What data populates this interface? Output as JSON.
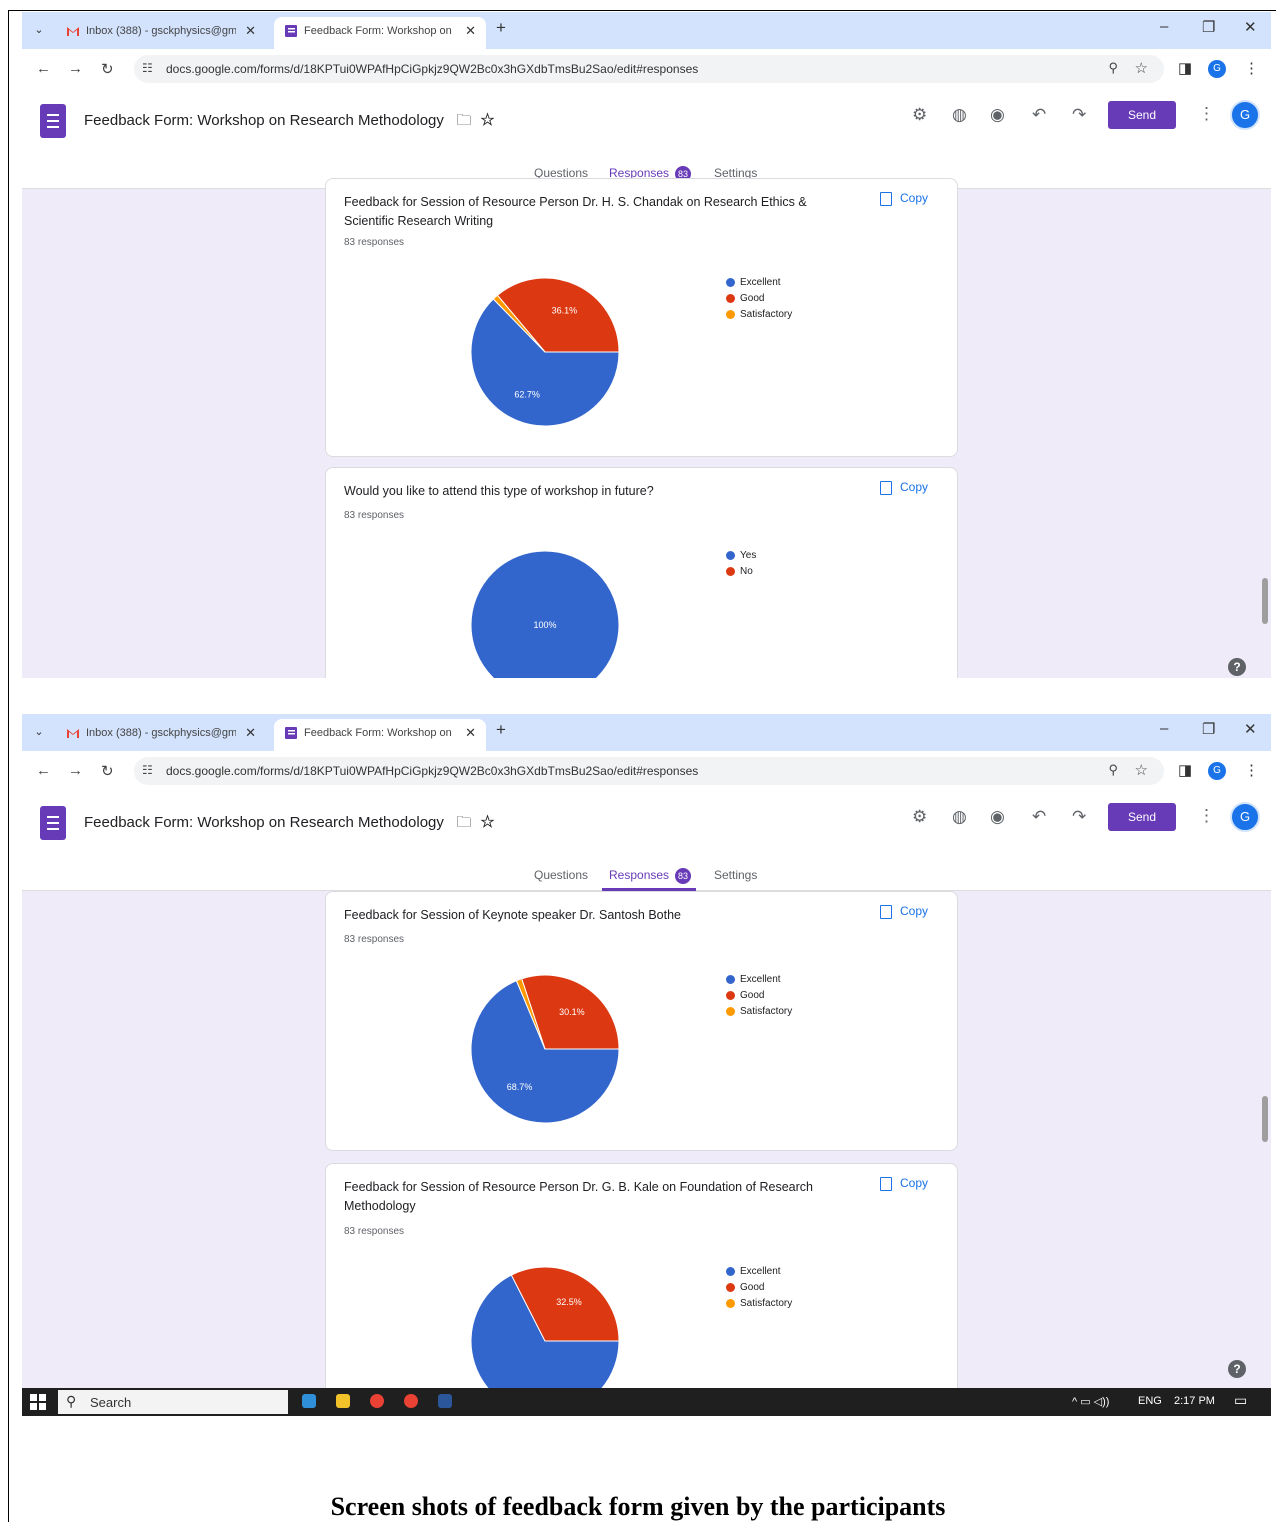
{
  "browser": {
    "tab_inactive_title": "Inbox (388) - gsckphysics@gm",
    "tab_active_title": "Feedback Form: Workshop on",
    "url": "docs.google.com/forms/d/18KPTui0WPAfHpCiGpkjz9QW2Bc0x3hGXdbTmsBu2Sao/edit#responses",
    "profile_initial": "G"
  },
  "form": {
    "title": "Feedback Form: Workshop on Research Methodology",
    "send_label": "Send",
    "avatar_initial": "G",
    "tabs": {
      "questions": "Questions",
      "responses": "Responses",
      "settings": "Settings"
    },
    "response_count": "83",
    "copy_label": "Copy"
  },
  "legend_excellent": [
    "Excellent",
    "Good",
    "Satisfactory"
  ],
  "legend_yesno": [
    "Yes",
    "No"
  ],
  "colors": {
    "blue": "#3366cc",
    "red": "#dc3912",
    "orange": "#ff9900",
    "purple": "#673ab7"
  },
  "cards": [
    {
      "question": "Feedback  for Session of Resource Person Dr. H. S. Chandak on Research Ethics & Scientific Research Writing",
      "responses": "83 responses",
      "chart_data": {
        "type": "pie",
        "categories": [
          "Excellent",
          "Good",
          "Satisfactory"
        ],
        "values": [
          62.7,
          36.1,
          1.2
        ],
        "labels": [
          "62.7%",
          "36.1%",
          ""
        ]
      }
    },
    {
      "question": "Would you like to attend this type of workshop in future?",
      "responses": "83 responses",
      "chart_data": {
        "type": "pie",
        "categories": [
          "Yes",
          "No"
        ],
        "values": [
          100,
          0
        ],
        "labels": [
          "100%",
          ""
        ]
      }
    },
    {
      "question": "Feedback  for Session of Keynote speaker Dr. Santosh Bothe",
      "responses": "83 responses",
      "chart_data": {
        "type": "pie",
        "categories": [
          "Excellent",
          "Good",
          "Satisfactory"
        ],
        "values": [
          68.7,
          30.1,
          1.2
        ],
        "labels": [
          "68.7%",
          "30.1%",
          ""
        ]
      }
    },
    {
      "question": "Feedback  for Session of Resource Person Dr. G. B. Kale on Foundation of Research Methodology",
      "responses": "83 responses",
      "chart_data": {
        "type": "pie",
        "categories": [
          "Excellent",
          "Good",
          "Satisfactory"
        ],
        "values": [
          67.5,
          32.5,
          0
        ],
        "labels": [
          "",
          "32.5%",
          ""
        ]
      }
    }
  ],
  "taskbar": {
    "search": "Search",
    "lang": "ENG",
    "time": "2:17 PM"
  },
  "caption": "Screen shots of feedback form given by the participants"
}
